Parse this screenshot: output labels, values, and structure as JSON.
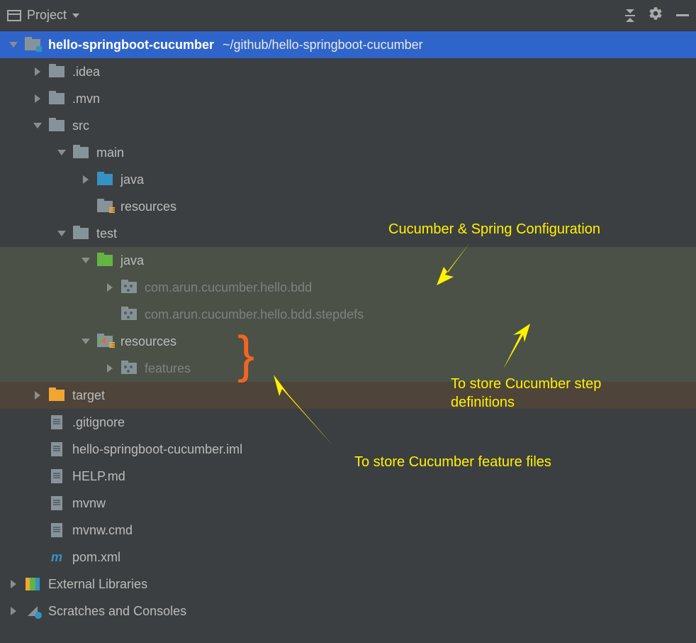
{
  "toolbar": {
    "title": "Project"
  },
  "tree": {
    "root": {
      "name": "hello-springboot-cucumber",
      "path": "~/github/hello-springboot-cucumber"
    },
    "idea": ".idea",
    "mvn": ".mvn",
    "src": "src",
    "main": "main",
    "main_java": "java",
    "main_resources": "resources",
    "test": "test",
    "test_java": "java",
    "pkg_bdd": "com.arun.cucumber.hello.bdd",
    "pkg_stepdefs": "com.arun.cucumber.hello.bdd.stepdefs",
    "test_resources": "resources",
    "features": "features",
    "target": "target",
    "gitignore": ".gitignore",
    "iml": "hello-springboot-cucumber.iml",
    "help": "HELP.md",
    "mvnw": "mvnw",
    "mvnw_cmd": "mvnw.cmd",
    "pom": "pom.xml",
    "ext_libs": "External Libraries",
    "scratches": "Scratches and Consoles"
  },
  "annotations": {
    "config": "Cucumber & Spring Configuration",
    "stepdefs_line1": "To store Cucumber step",
    "stepdefs_line2": "definitions",
    "features": "To store Cucumber feature files"
  },
  "colors": {
    "selected": "#2f65ca",
    "highlight_green": "#4b5147",
    "highlight_brown": "#4e4439",
    "annotation": "#fff200",
    "brace": "#f26522"
  },
  "icons": {
    "xml_glyph": "m"
  }
}
